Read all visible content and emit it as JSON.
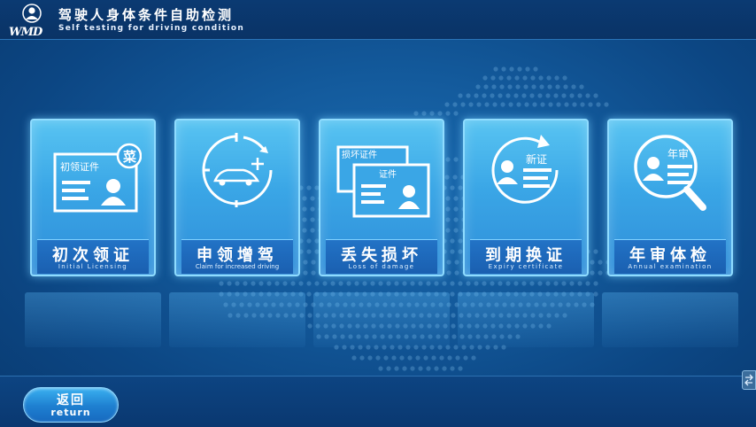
{
  "header": {
    "logo_text": "WMD",
    "title_cn": "驾驶人身体条件自助检测",
    "title_en": "Self testing for driving condition"
  },
  "cards": [
    {
      "cn": "初次领证",
      "en": "Initial Licensing",
      "icon": "id-card-new-icon",
      "icon_text": "初领证件",
      "stamp": "菜"
    },
    {
      "cn": "申领增驾",
      "en": "Claim for increased driving",
      "icon": "car-add-icon"
    },
    {
      "cn": "丢失损坏",
      "en": "Loss of damage",
      "icon": "lost-certificate-icon",
      "icon_text": "损坏证件",
      "icon_text2": "证件"
    },
    {
      "cn": "到期换证",
      "en": "Expiry certificate",
      "icon": "renew-certificate-icon",
      "icon_text": "新证"
    },
    {
      "cn": "年审体检",
      "en": "Annual examination",
      "icon": "annual-search-icon",
      "icon_text": "年审"
    }
  ],
  "footer": {
    "return_cn": "返回",
    "return_en": "return"
  },
  "colors": {
    "card_top": "#58c4f2",
    "card_bottom": "#2f8ed9",
    "label_bar": "#1a5fb0",
    "background": "#135a9c"
  }
}
